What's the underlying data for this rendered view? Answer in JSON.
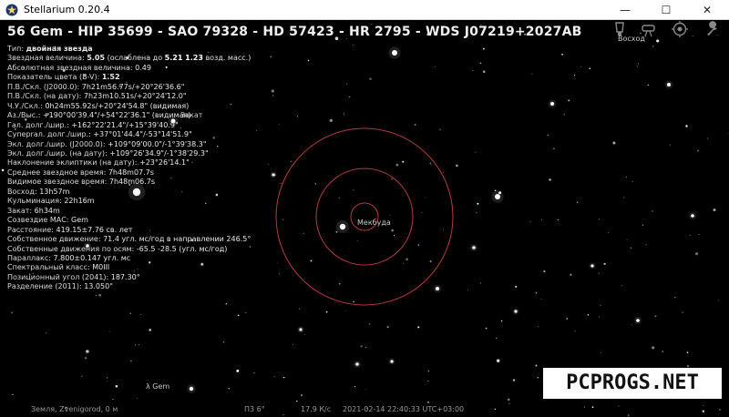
{
  "window": {
    "title": "Stellarium 0.20.4",
    "minimize_glyph": "—",
    "maximize_glyph": "☐",
    "close_glyph": "✕"
  },
  "object": {
    "title": "56 Gem - HIP 35699 - SAO 79328 - HD 57423 - HR 2795 - WDS J07219+2027AB"
  },
  "info": {
    "lines": [
      {
        "label": "Тип: ",
        "value": "двойная звезда",
        "bold_value": true
      },
      {
        "label": "Звездная величина: ",
        "value": "5.05",
        "suffix": " (ослаблена до ",
        "value2": "5.21 1.23",
        "suffix2": " возд. масс.)",
        "bold_value": true
      },
      {
        "label": "Абсолютная звездная величина: ",
        "value": "0.49"
      },
      {
        "label": "Показатель цвета (B-V): ",
        "value": "1.52",
        "bold_value": true
      },
      {
        "label": "П.В./Скл. (J2000.0): ",
        "value": "7h21m56.77s/+20°26'36.6\""
      },
      {
        "label": "П.В./Скл. (на дату): ",
        "value": "7h23m10.51s/+20°24'12.0\""
      },
      {
        "label": "Ч.У./Скл.: ",
        "value": "0h24m55.92s/+20°24'54.8\" (видимая)"
      },
      {
        "label": "Аз./Выс.: ",
        "value": "+190°00'39.4\"/+54°22'36.1\" (видимая)"
      },
      {
        "label": "Гал. долг./шир.: ",
        "value": "+162°22'21.4\"/+15°39'40.9\""
      },
      {
        "label": "Суперrал. долг./шир.: ",
        "value": "+37°01'44.4\"/-53°14'51.9\""
      },
      {
        "label": "Экл. долг./шир. (J2000.0): ",
        "value": "+109°09'00.0\"/-1°39'38.3\""
      },
      {
        "label": "Экл. долг./шир. (на дату): ",
        "value": "+109°26'34.9\"/-1°38'29.3\""
      },
      {
        "label": "Наклонение эклиптики (на дату): ",
        "value": "+23°26'14.1\""
      },
      {
        "label": "Среднее звездное время: ",
        "value": "7h48m07.7s"
      },
      {
        "label": "Видимое звездное время: ",
        "value": "7h48m06.7s"
      },
      {
        "label": "Восход: ",
        "value": "13h57m"
      },
      {
        "label": "Кульминация: ",
        "value": "22h16m"
      },
      {
        "label": "Закат: ",
        "value": "6h34m"
      },
      {
        "label": "Созвездие МАС: ",
        "value": "Gem"
      },
      {
        "label": "Расстояние: ",
        "value": "419.15±7.76 св. лет"
      },
      {
        "label": "Собственное движение: ",
        "value": "71.4 угл. мс/год в направлении 246.5°"
      },
      {
        "label": "Собственные движения по осям: ",
        "value": "-65.5 -28.5 (угл. мс/год)"
      },
      {
        "label": "Параллакс: ",
        "value": "7.800±0.147 угл. мс"
      },
      {
        "label": "Спектральный класс: ",
        "value": "M0III"
      },
      {
        "label": "Позиционный угол (2041): ",
        "value": "187.30°"
      },
      {
        "label": "Разделение (2011): ",
        "value": "13.050\""
      }
    ]
  },
  "sky_labels": {
    "mekbuda": "Мекбуда",
    "lambda_gem": "λ Gem",
    "zakat": "Закат",
    "vosxod": "Восход"
  },
  "status": {
    "location": "Земля, Zvenigorod, 0 м",
    "fov": "П3 6°",
    "fps": "17.9 К/с",
    "datetime": "2021-02-14 22:40:33 UTC+03:00"
  },
  "watermark": {
    "text": "PCPROGS.NET"
  },
  "colors": {
    "circle": "#b8383a",
    "text": "#e0e0e0",
    "sky": "#000000"
  },
  "icons": {
    "toolbar": [
      "scope-icon",
      "telescope-icon",
      "ocular-icon",
      "settings-icon"
    ]
  }
}
